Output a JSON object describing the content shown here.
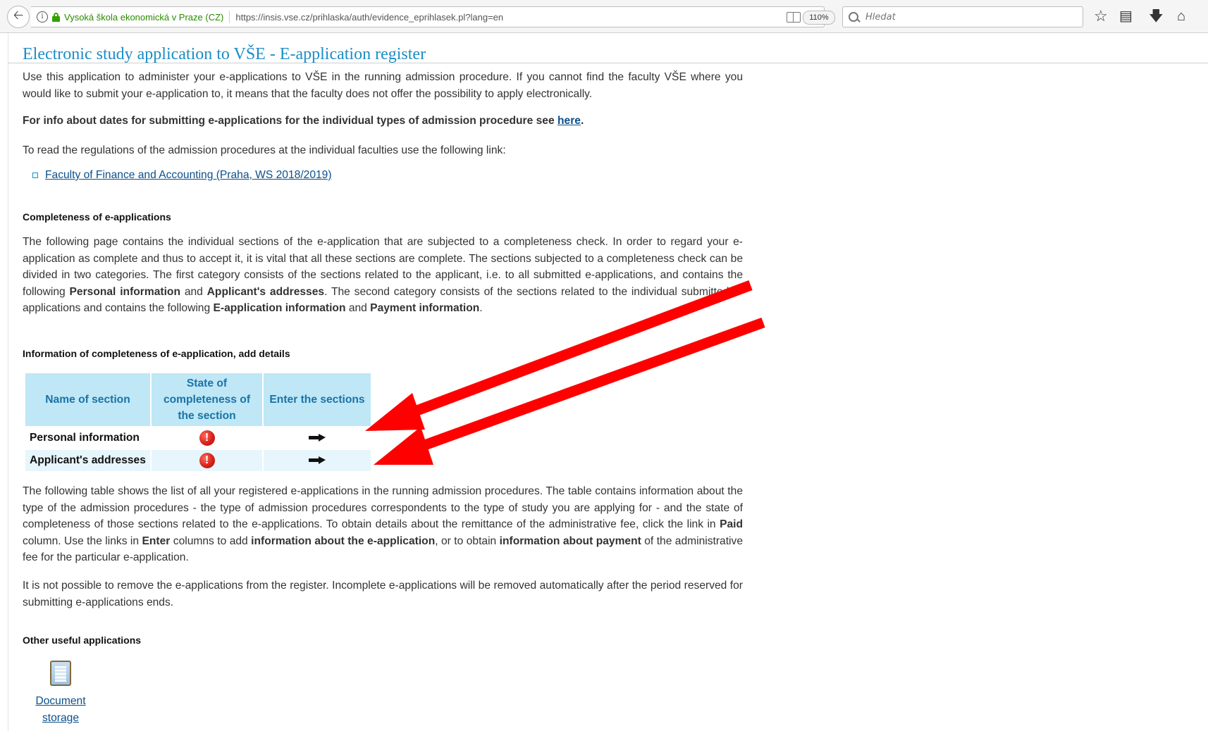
{
  "browser": {
    "org_name": "Vysoká škola ekonomická v Praze (CZ)",
    "url": "https://insis.vse.cz/prihlaska/auth/evidence_eprihlasek.pl?lang=en",
    "zoom": "110%",
    "search_placeholder": "Hledat",
    "icons": [
      "back-arrow-icon",
      "info-icon",
      "lock-icon",
      "reader-icon",
      "reload-icon",
      "search-icon",
      "star-icon",
      "library-icon",
      "download-icon",
      "home-icon"
    ]
  },
  "page": {
    "title": "Electronic study application to VŠE - E-application register",
    "intro": "Use this application to administer your e-applications to VŠE in the running admission procedure. If you cannot find the faculty VŠE where you would like to submit your e-application to, it means that the faculty does not offer the possibility to apply electronically.",
    "dates_info_prefix": "For info about dates for submitting e-applications for the individual types of admission procedure see ",
    "dates_info_link": "here",
    "dates_info_suffix": ".",
    "regulations_text": "To read the regulations of the admission procedures at the individual faculties use the following link:",
    "faculty_link": "Faculty of Finance and Accounting (Praha, WS 2018/2019)",
    "completeness_heading": "Completeness of e-applications",
    "completeness_p": {
      "t1": "The following page contains the individual sections of the e-application that are subjected to a completeness check. In order to regard your e-application as complete and thus to accept it, it is vital that all these sections are complete. The sections subjected to a completeness check can be divided in two categories. The first category consists of the sections related to the applicant, i.e. to all submitted e-applications, and contains the following ",
      "b1": "Personal information",
      "t2": " and ",
      "b2": "Applicant's addresses",
      "t3": ". The second category consists of the sections related to the individual submitted e-applications and contains the following ",
      "b3": "E-application information",
      "t4": " and ",
      "b4": "Payment information",
      "t5": "."
    },
    "info_heading": "Information of completeness of e-application, add details",
    "table": {
      "headers": [
        "Name of section",
        "State of completeness of the section",
        "Enter the sections"
      ],
      "rows": [
        {
          "name": "Personal information",
          "state": "!",
          "state_icon": "error-icon",
          "enter_icon": "arrow-right-icon"
        },
        {
          "name": "Applicant's addresses",
          "state": "!",
          "state_icon": "error-icon",
          "enter_icon": "arrow-right-icon"
        }
      ]
    },
    "list_p": {
      "t1": "The following table shows the list of all your registered e-applications in the running admission procedures. The table contains information about the type of the admission procedures - the type of admission procedures correspondents to the type of study you are applying for - and the state of completeness of those sections related to the e-applications. To obtain details about the remittance of the administrative fee, click the link in ",
      "b1": "Paid",
      "t2": " column. Use the links in ",
      "b2": "Enter",
      "t3": " columns to add ",
      "b3": "information about the e-application",
      "t4": ", or to obtain ",
      "b4": "information about payment",
      "t5": " of the administrative fee for the particular e-application."
    },
    "remove_p": "It is not possible to remove the e-applications from the register. Incomplete e-applications will be removed automatically after the period reserved for submitting e-applications ends.",
    "other_heading": "Other useful applications",
    "apps": [
      {
        "label": "Document storage",
        "icon": "document-storage-icon"
      }
    ]
  },
  "annotation": {
    "color": "#ff0000",
    "arrow_count": 2
  }
}
